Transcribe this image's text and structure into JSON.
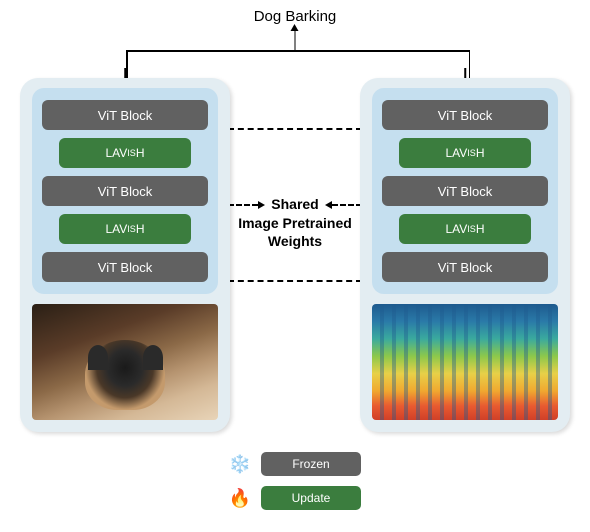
{
  "output_label": "Dog Barking",
  "shared_text": {
    "line1": "Shared",
    "line2": "Image Pretrained",
    "line3": "Weights"
  },
  "blocks": {
    "vit": "ViT Block",
    "lavish_pre": "LAV",
    "lavish_small": "IS",
    "lavish_post": "H"
  },
  "legend": {
    "frozen": "Frozen",
    "update": "Update"
  },
  "chart_data": {
    "type": "diagram",
    "description": "Dual-branch architecture diagram. Two parallel encoders (left: image of a dog, right: audio spectrogram) each pass through a stack of 3 frozen ViT Blocks interleaved with 2 trainable LAVISH adapter blocks. Corresponding ViT Blocks across the two branches share image-pretrained weights (indicated by bidirectional dashed arrows). Outputs of both branches are combined to predict the label 'Dog Barking'. Legend: snowflake icon + gray pill = Frozen; flame icon + green pill = Update.",
    "left_input": "dog image",
    "right_input": "audio spectrogram",
    "stack": [
      "ViT Block",
      "LAVISH",
      "ViT Block",
      "LAVISH",
      "ViT Block"
    ],
    "frozen_blocks": "ViT Block",
    "updated_blocks": "LAVISH",
    "output": "Dog Barking"
  }
}
